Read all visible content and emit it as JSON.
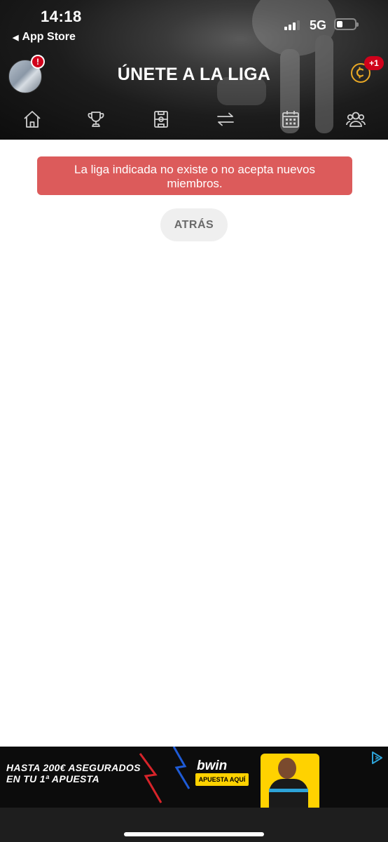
{
  "status_bar": {
    "time": "14:18",
    "back_app": "App Store",
    "network": "5G"
  },
  "header": {
    "title": "ÚNETE A LA LIGA",
    "avatar_badge": "!",
    "coin_badge": "+1",
    "accent_color": "#e9a825",
    "badge_color": "#d0021b"
  },
  "nav": {
    "items": [
      {
        "icon": "home-icon"
      },
      {
        "icon": "trophy-icon"
      },
      {
        "icon": "field-icon"
      },
      {
        "icon": "transfer-icon"
      },
      {
        "icon": "calendar-icon"
      },
      {
        "icon": "users-icon"
      }
    ]
  },
  "main": {
    "alert_text": "La liga indicada no existe o no acepta nuevos miembros.",
    "alert_color": "#dc5b5b",
    "back_button": "ATRÁS"
  },
  "ad": {
    "line1": "HASTA 200€ ASEGURADOS",
    "line2": "EN TU 1ª APUESTA",
    "brand": "bwin",
    "cta": "APUESTA AQUÍ"
  }
}
